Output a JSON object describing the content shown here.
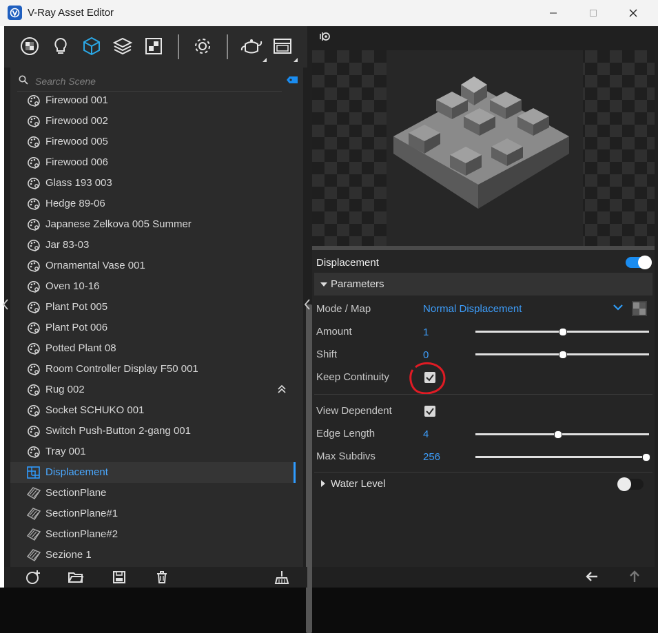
{
  "window": {
    "title": "V-Ray Asset Editor",
    "controls": {
      "minimize": "minimize",
      "maximize": "maximize",
      "close": "close"
    }
  },
  "toolbar": {
    "tools": [
      "materials-icon",
      "lights-icon",
      "geometry-icon",
      "layers-icon",
      "render-elements-icon",
      "settings-icon",
      "teapot-render-icon",
      "frame-buffer-icon"
    ],
    "active_tool": "geometry-icon",
    "accent": "#2ba8e6"
  },
  "search": {
    "placeholder": "Search Scene",
    "value": ""
  },
  "list": {
    "items": [
      {
        "label": "Firewood 001",
        "kind": "asset"
      },
      {
        "label": "Firewood 002",
        "kind": "asset"
      },
      {
        "label": "Firewood 005",
        "kind": "asset"
      },
      {
        "label": "Firewood 006",
        "kind": "asset"
      },
      {
        "label": "Glass 193 003",
        "kind": "asset"
      },
      {
        "label": "Hedge 89-06",
        "kind": "asset"
      },
      {
        "label": "Japanese Zelkova 005 Summer",
        "kind": "asset"
      },
      {
        "label": "Jar 83-03",
        "kind": "asset"
      },
      {
        "label": "Ornamental Vase 001",
        "kind": "asset"
      },
      {
        "label": "Oven 10-16",
        "kind": "asset"
      },
      {
        "label": "Plant Pot 005",
        "kind": "asset"
      },
      {
        "label": "Plant Pot 006",
        "kind": "asset"
      },
      {
        "label": "Potted Plant 08",
        "kind": "asset"
      },
      {
        "label": "Room Controller Display F50 001",
        "kind": "asset"
      },
      {
        "label": "Rug 002",
        "kind": "asset"
      },
      {
        "label": "Socket SCHUKO 001",
        "kind": "asset"
      },
      {
        "label": "Switch Push-Button 2-gang 001",
        "kind": "asset"
      },
      {
        "label": "Tray 001",
        "kind": "asset"
      },
      {
        "label": "Displacement",
        "kind": "displacement",
        "selected": true
      },
      {
        "label": "SectionPlane",
        "kind": "section"
      },
      {
        "label": "SectionPlane#1",
        "kind": "section"
      },
      {
        "label": "SectionPlane#2",
        "kind": "section"
      },
      {
        "label": "Sezione 1",
        "kind": "section"
      }
    ]
  },
  "bottom_bar": {
    "buttons": [
      "add-asset-icon",
      "open-folder-icon",
      "save-icon",
      "delete-icon",
      "purge-icon"
    ],
    "right_buttons": [
      "import-arrow-icon",
      "upload-arrow-icon"
    ]
  },
  "properties": {
    "title": "Displacement",
    "enabled": true,
    "parameters_label": "Parameters",
    "mode_label": "Mode / Map",
    "mode_value": "Normal Displacement",
    "amount_label": "Amount",
    "amount_value": "1",
    "amount_level": 0.5,
    "shift_label": "Shift",
    "shift_value": "0",
    "shift_level": 0.5,
    "keep_continuity_label": "Keep Continuity",
    "keep_continuity_checked": true,
    "view_dependent_label": "View Dependent",
    "view_dependent_checked": true,
    "edge_length_label": "Edge Length",
    "edge_length_value": "4",
    "edge_length_level": 0.47,
    "max_subdivs_label": "Max Subdivs",
    "max_subdivs_value": "256",
    "max_subdivs_level": 1.0,
    "water_level_label": "Water Level",
    "water_level_enabled": false,
    "accent": "#3d9dfa"
  },
  "annotation": {
    "color": "#e01b24",
    "target": "keep-continuity-checkbox"
  }
}
